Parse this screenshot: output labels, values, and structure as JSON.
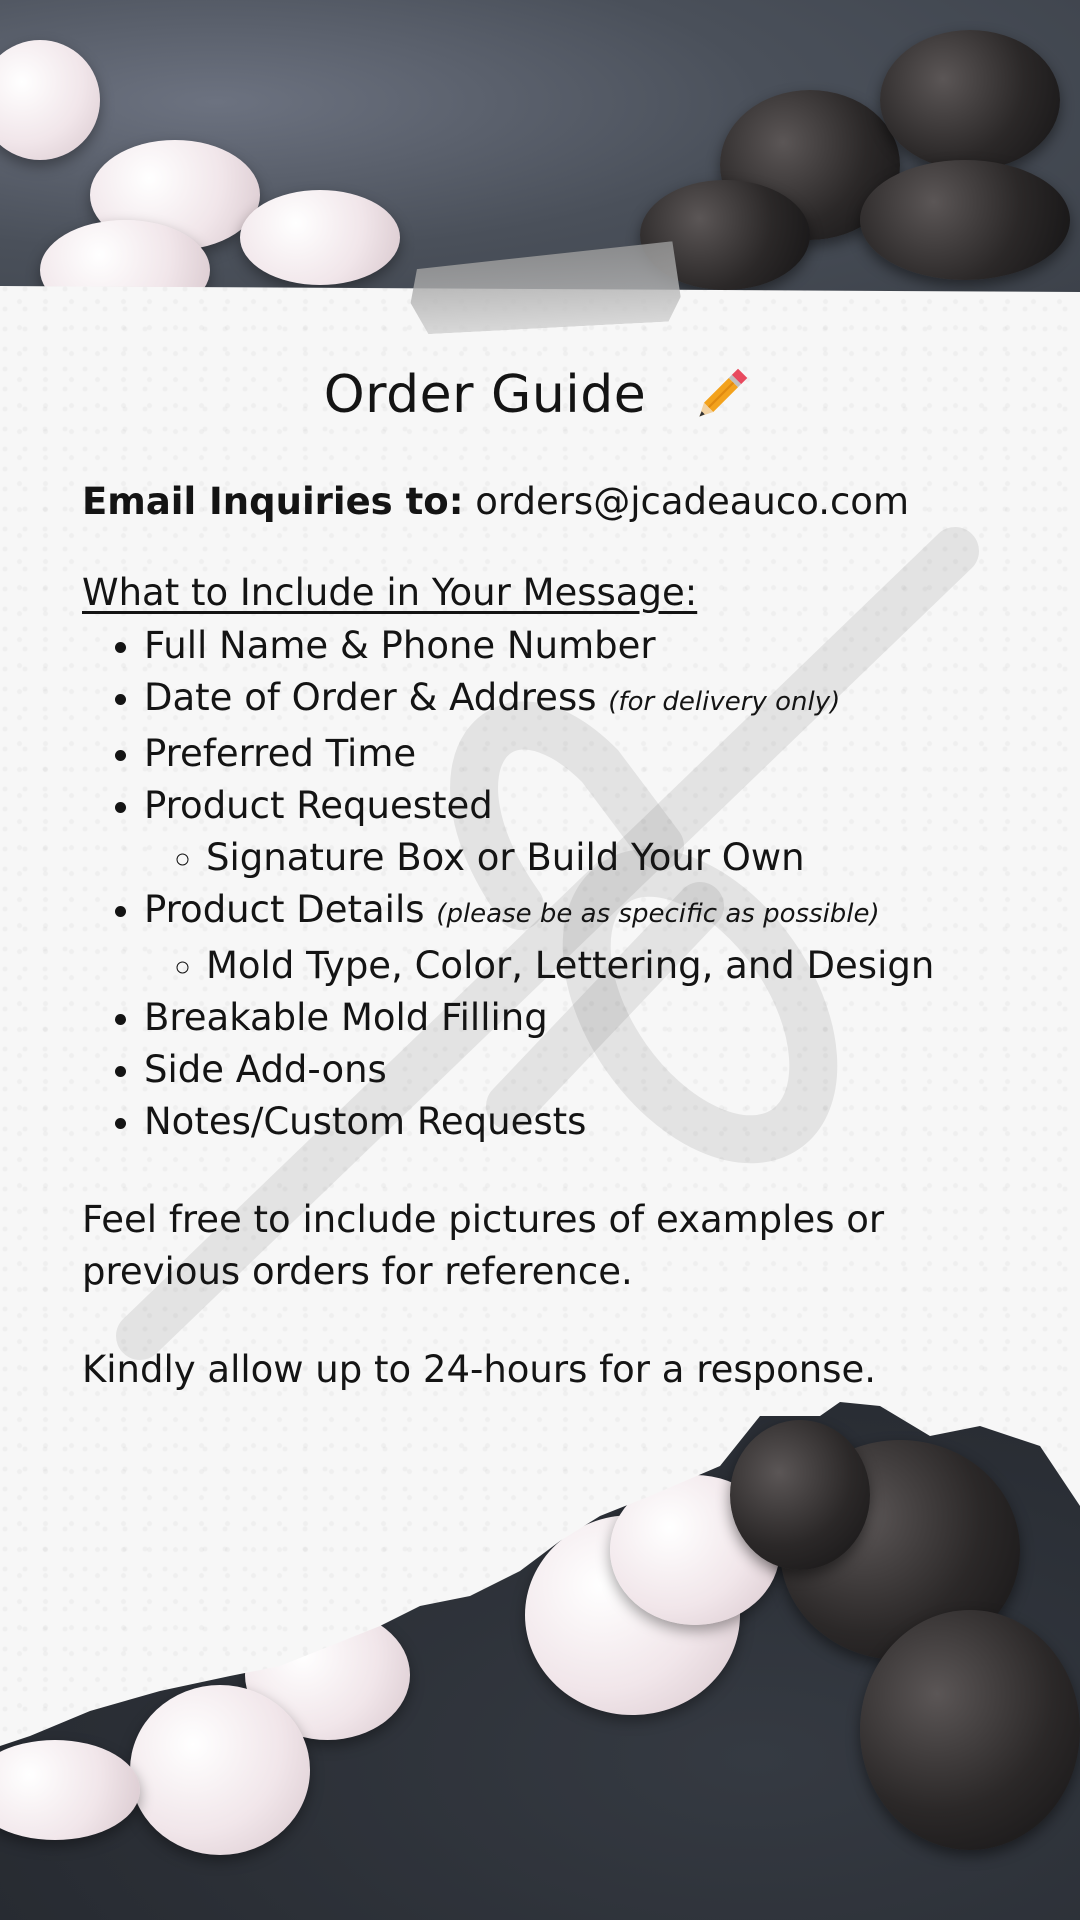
{
  "title": "Order Guide",
  "icons": {
    "title_icon": "pencil-icon",
    "watermark": "scissors-icon"
  },
  "email": {
    "label": "Email Inquiries to:",
    "address": "orders@jcadeauco.com"
  },
  "include_heading": "What to Include in Your Message:",
  "items": {
    "full_name": "Full Name & Phone Number",
    "date_address": "Date of Order & Address",
    "date_address_note": "(for delivery only)",
    "preferred_time": "Preferred Time",
    "product_requested": "Product Requested",
    "product_requested_sub": "Signature Box or Build Your Own",
    "product_details": "Product Details",
    "product_details_note": "(please be as specific as possible)",
    "product_details_sub": "Mold Type, Color, Lettering, and Design",
    "breakable_filling": "Breakable Mold Filling",
    "side_addons": "Side Add-ons",
    "notes_custom": "Notes/Custom Requests"
  },
  "pictures_note": "Feel free to include pictures of examples or previous orders for reference.",
  "response_note": "Kindly allow up to 24-hours for a response.",
  "colors": {
    "text": "#141414",
    "paper": "#f7f7f7",
    "background": "#3a3f47"
  }
}
